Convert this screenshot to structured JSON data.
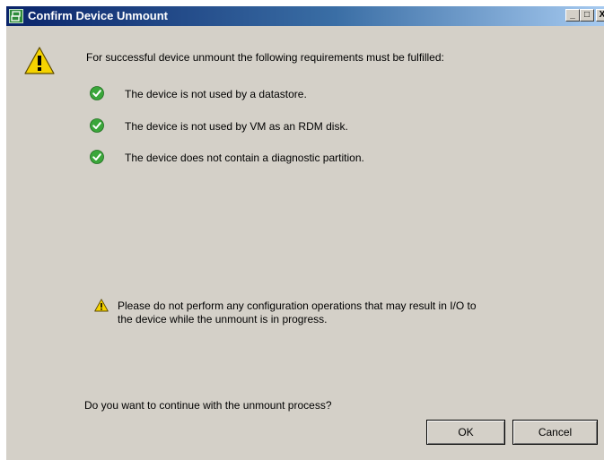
{
  "window": {
    "title": "Confirm Device Unmount",
    "controls": {
      "minimize": "_",
      "maximize": "□",
      "close": "X"
    }
  },
  "message": {
    "intro": "For successful device unmount the following requirements must be fulfilled:",
    "requirements": [
      {
        "text": "The device is not used by a datastore.",
        "status_icon": "check-icon"
      },
      {
        "text": "The device is not used by VM as an RDM disk.",
        "status_icon": "check-icon"
      },
      {
        "text": "The device does not contain a diagnostic partition.",
        "status_icon": "check-icon"
      }
    ],
    "warning_line1": "Please do not perform any configuration operations that may result in I/O to",
    "warning_line2": "the device while the unmount is in progress.",
    "question": "Do you want to continue with the unmount process?"
  },
  "buttons": {
    "ok": "OK",
    "cancel": "Cancel"
  },
  "colors": {
    "titlebar_start": "#0a246a",
    "titlebar_end": "#a6caf0",
    "dialog_bg": "#d4d0c8",
    "check_green": "#3aa63a",
    "warning_yellow": "#f5d300"
  }
}
